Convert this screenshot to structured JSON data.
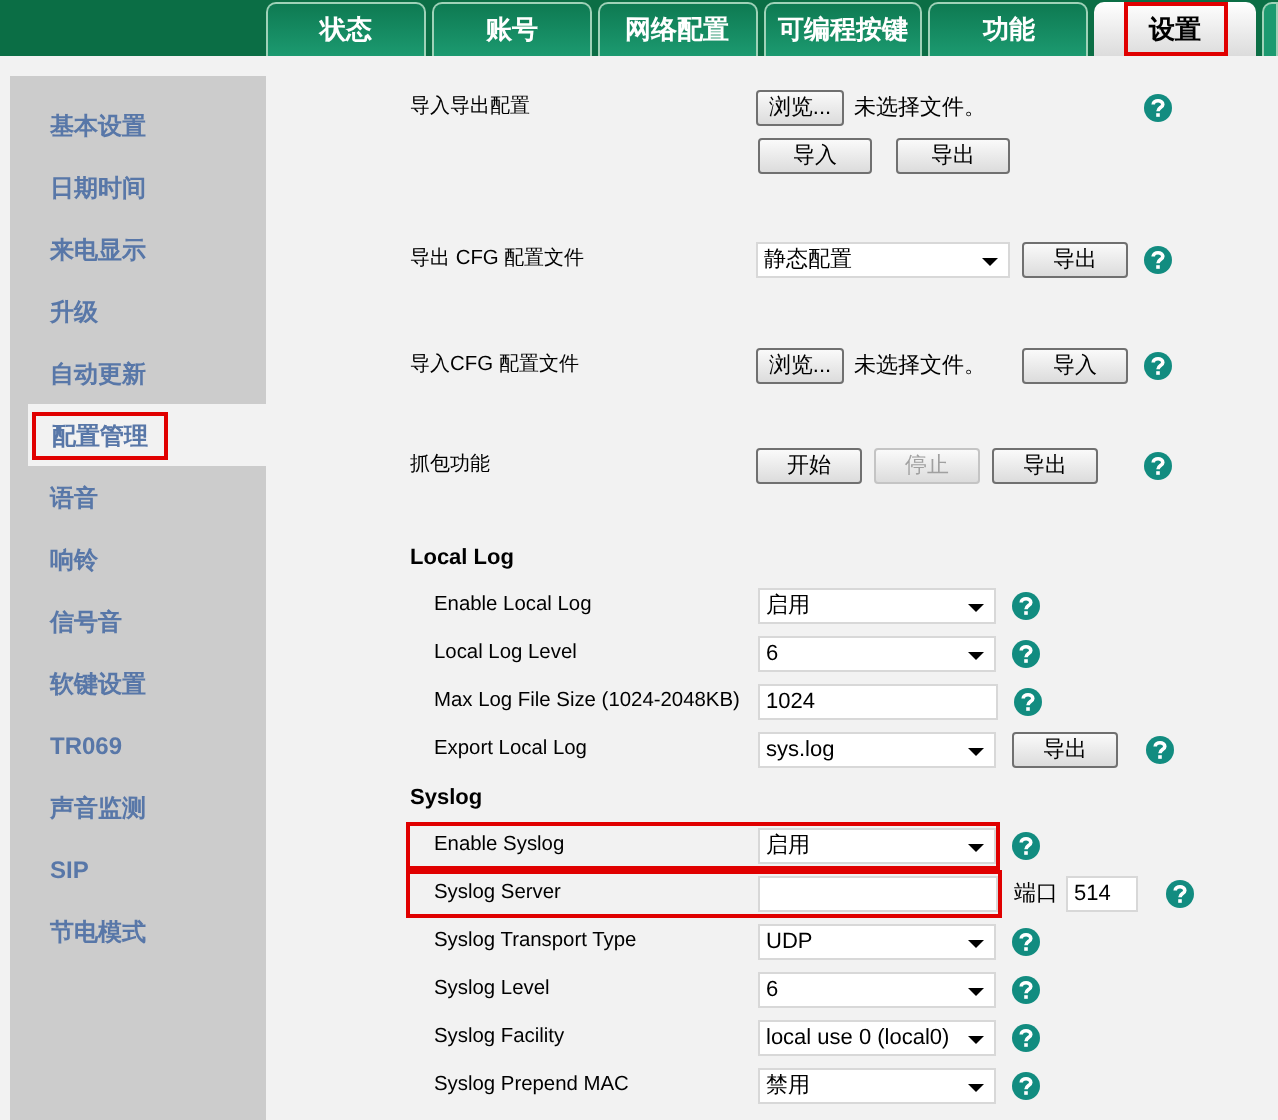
{
  "tabs": [
    {
      "label": "状态",
      "selected": false,
      "highlight": false
    },
    {
      "label": "账号",
      "selected": false,
      "highlight": false
    },
    {
      "label": "网络配置",
      "selected": false,
      "highlight": false
    },
    {
      "label": "可编程按键",
      "selected": false,
      "highlight": false
    },
    {
      "label": "功能",
      "selected": false,
      "highlight": false
    },
    {
      "label": "设置",
      "selected": true,
      "highlight": true
    }
  ],
  "sidebar": {
    "items": [
      {
        "label": "基本设置",
        "selected": false,
        "highlight": false
      },
      {
        "label": "日期时间",
        "selected": false,
        "highlight": false
      },
      {
        "label": "来电显示",
        "selected": false,
        "highlight": false
      },
      {
        "label": "升级",
        "selected": false,
        "highlight": false
      },
      {
        "label": "自动更新",
        "selected": false,
        "highlight": false
      },
      {
        "label": "配置管理",
        "selected": true,
        "highlight": true
      },
      {
        "label": "语音",
        "selected": false,
        "highlight": false
      },
      {
        "label": "响铃",
        "selected": false,
        "highlight": false
      },
      {
        "label": "信号音",
        "selected": false,
        "highlight": false
      },
      {
        "label": "软键设置",
        "selected": false,
        "highlight": false
      },
      {
        "label": "TR069",
        "selected": false,
        "highlight": false
      },
      {
        "label": "声音监测",
        "selected": false,
        "highlight": false
      },
      {
        "label": "SIP",
        "selected": false,
        "highlight": false
      },
      {
        "label": "节电模式",
        "selected": false,
        "highlight": false
      }
    ]
  },
  "config_rows": [
    {
      "label": "导入导出配置",
      "controls": [
        {
          "kind": "file",
          "button": "浏览...",
          "status": "未选择文件。"
        }
      ],
      "second_line": [
        {
          "kind": "button",
          "label": "导入",
          "disabled": false
        },
        {
          "kind": "button",
          "label": "导出",
          "disabled": false
        }
      ]
    },
    {
      "label": "导出 CFG 配置文件",
      "controls": [
        {
          "kind": "select",
          "value": "静态配置"
        },
        {
          "kind": "button",
          "label": "导出",
          "disabled": false
        }
      ]
    },
    {
      "label": "导入CFG 配置文件",
      "controls": [
        {
          "kind": "file",
          "button": "浏览...",
          "status": "未选择文件。"
        },
        {
          "kind": "button",
          "label": "导入",
          "disabled": false
        }
      ]
    },
    {
      "label": "抓包功能",
      "controls": [
        {
          "kind": "button",
          "label": "开始",
          "disabled": false
        },
        {
          "kind": "button",
          "label": "停止",
          "disabled": true
        },
        {
          "kind": "button",
          "label": "导出",
          "disabled": false
        }
      ]
    }
  ],
  "sections": [
    {
      "title": "Local Log",
      "rows": [
        {
          "label": "Enable Local Log",
          "highlight": false,
          "controls": [
            {
              "kind": "select",
              "value": "启用"
            }
          ]
        },
        {
          "label": "Local Log Level",
          "highlight": false,
          "controls": [
            {
              "kind": "select",
              "value": "6"
            }
          ]
        },
        {
          "label": "Max Log File Size (1024-2048KB)",
          "highlight": false,
          "controls": [
            {
              "kind": "input",
              "value": "1024"
            }
          ]
        },
        {
          "label": "Export Local Log",
          "highlight": false,
          "controls": [
            {
              "kind": "select",
              "value": "sys.log"
            },
            {
              "kind": "button",
              "label": "导出",
              "disabled": false
            }
          ]
        }
      ]
    },
    {
      "title": "Syslog",
      "rows": [
        {
          "label": "Enable Syslog",
          "highlight": true,
          "controls": [
            {
              "kind": "select",
              "value": "启用"
            }
          ]
        },
        {
          "label": "Syslog Server",
          "highlight": true,
          "controls": [
            {
              "kind": "input"
            },
            {
              "kind": "port",
              "label": "端口",
              "value": "514"
            }
          ]
        },
        {
          "label": "Syslog Transport Type",
          "highlight": false,
          "controls": [
            {
              "kind": "select",
              "value": "UDP"
            }
          ]
        },
        {
          "label": "Syslog Level",
          "highlight": false,
          "controls": [
            {
              "kind": "select",
              "value": "6"
            }
          ]
        },
        {
          "label": "Syslog Facility",
          "highlight": false,
          "controls": [
            {
              "kind": "select",
              "value": "local use 0 (local0)"
            }
          ]
        },
        {
          "label": "Syslog Prepend MAC",
          "highlight": false,
          "controls": [
            {
              "kind": "select",
              "value": "禁用"
            }
          ]
        }
      ]
    }
  ]
}
